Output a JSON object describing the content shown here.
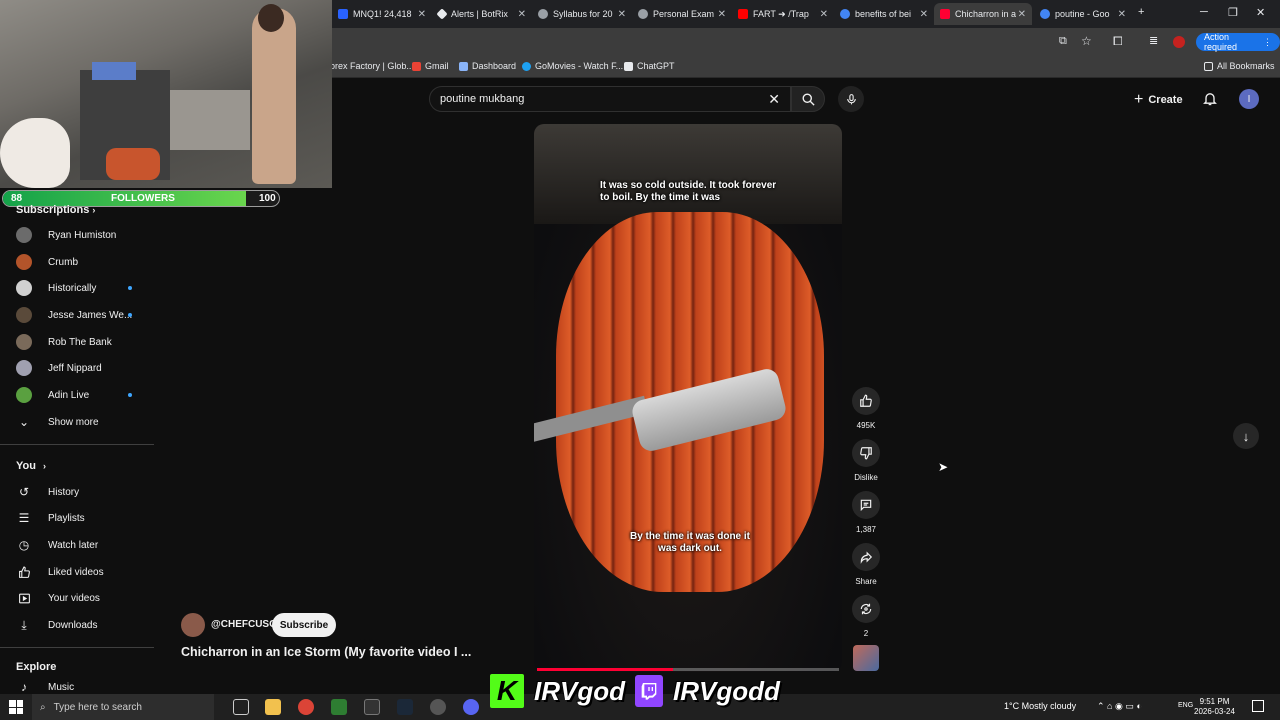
{
  "browser": {
    "tabs": [
      {
        "label": "MNQ1! 24,418",
        "color": "#2962ff"
      },
      {
        "label": "Alerts | BotRix",
        "color": "#e8eaed"
      },
      {
        "label": "Syllabus for 20",
        "color": "#9aa0a6"
      },
      {
        "label": "Personal Exam",
        "color": "#9aa0a6"
      },
      {
        "label": "FART ➜ /Trap",
        "color": "#ff0000"
      },
      {
        "label": "benefits of bei",
        "color": "#4285f4"
      },
      {
        "label": "Chicharron in a",
        "color": "#ff0033"
      },
      {
        "label": "poutine - Goo",
        "color": "#4285f4"
      }
    ],
    "action_required": "Action required",
    "bookmarks": [
      "orex Factory | Glob...",
      "Gmail",
      "Dashboard",
      "GoMovies - Watch F...",
      "ChatGPT"
    ],
    "all_bookmarks": "All Bookmarks"
  },
  "overlay": {
    "followers_current": "88",
    "followers_label": "FOLLOWERS",
    "followers_goal": "100",
    "followers_progress": 0.88,
    "brand_kick": "IRVgod",
    "brand_twitch": "IRVgodd"
  },
  "sidebar": {
    "subscriptions_heading": "Subscriptions",
    "channels": [
      {
        "name": "Ryan Humiston",
        "color": "#6b6b6b",
        "dot": false
      },
      {
        "name": "Crumb",
        "color": "#b3542a",
        "dot": false
      },
      {
        "name": "Historically",
        "color": "#d0d0d0",
        "dot": true
      },
      {
        "name": "Jesse James We...",
        "color": "#5a4a3a",
        "dot": true
      },
      {
        "name": "Rob The Bank",
        "color": "#7a6a5a",
        "dot": false
      },
      {
        "name": "Jeff Nippard",
        "color": "#a0a0b0",
        "dot": false
      },
      {
        "name": "Adin Live",
        "color": "#5aa040",
        "dot": true
      }
    ],
    "show_more": "Show more",
    "you_heading": "You",
    "you_items": [
      {
        "label": "History",
        "icon": "history-icon"
      },
      {
        "label": "Playlists",
        "icon": "playlists-icon"
      },
      {
        "label": "Watch later",
        "icon": "clock-icon"
      },
      {
        "label": "Liked videos",
        "icon": "thumbs-up-icon"
      },
      {
        "label": "Your videos",
        "icon": "play-icon"
      },
      {
        "label": "Downloads",
        "icon": "download-icon"
      }
    ],
    "explore_heading": "Explore",
    "explore_items": [
      {
        "label": "Music"
      }
    ]
  },
  "header": {
    "search_value": "poutine mukbang",
    "create_label": "Create",
    "avatar_letter": "I"
  },
  "video": {
    "caption_top": "It was so cold outside. It took forever to boil. By the time it was",
    "caption_bottom": "By the time it was done it was dark out.",
    "progress": 0.45,
    "channel": "@CHEFCUSO",
    "subscribe_label": "Subscribe",
    "title": "Chicharron in an Ice Storm (My favorite video I ..."
  },
  "actions": {
    "likes": "495K",
    "dislike_label": "Dislike",
    "comments": "1,387",
    "share_label": "Share",
    "remix_count": "2"
  },
  "taskbar": {
    "search_placeholder": "Type here to search",
    "weather": "1°C  Mostly cloudy",
    "language": "ENG",
    "time": "9:51 PM",
    "date": "2026-03-24"
  }
}
